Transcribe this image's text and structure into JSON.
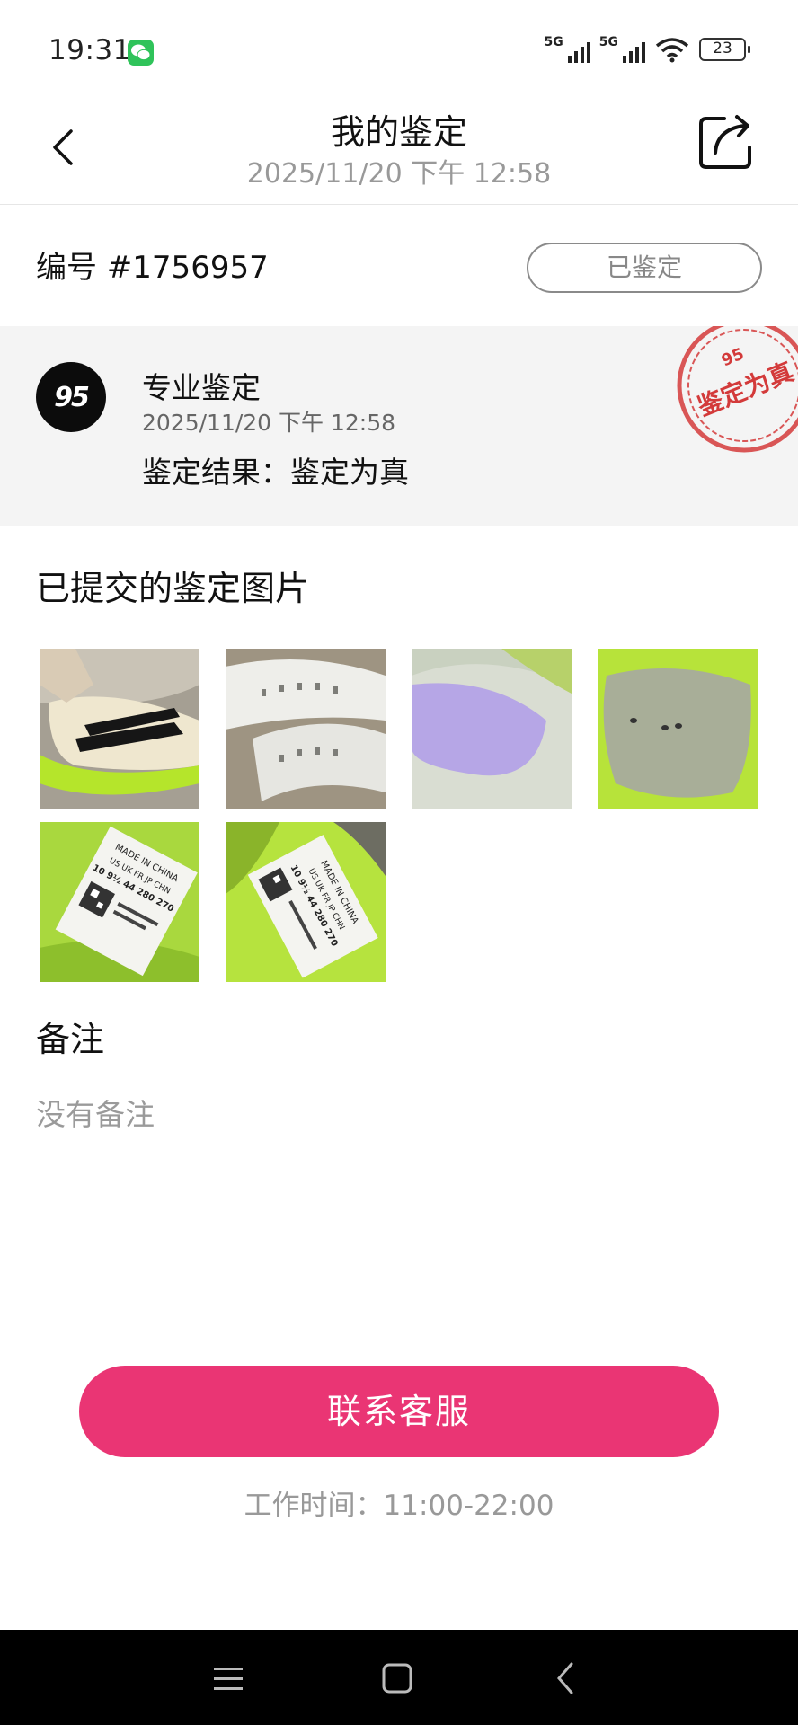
{
  "status_bar": {
    "time": "19:31",
    "battery": "23",
    "network_1": "5G",
    "network_2": "5G"
  },
  "header": {
    "title": "我的鉴定",
    "subtitle": "2025/11/20 下午 12:58"
  },
  "order": {
    "number": "编号 #1756957",
    "status": "已鉴定"
  },
  "result": {
    "logo_text": "95",
    "type": "专业鉴定",
    "time": "2025/11/20 下午 12:58",
    "line": "鉴定结果：鉴定为真",
    "stamp_text": "鉴定为真"
  },
  "images_section": {
    "title": "已提交的鉴定图片",
    "label_lines": [
      "MADE IN CHINA",
      "US UK FR JP CHN",
      "10 9½ 44 280 270"
    ]
  },
  "remark": {
    "title": "备注",
    "text": "没有备注"
  },
  "contact": {
    "button": "联系客服",
    "work_hours": "工作时间：11:00-22:00"
  },
  "colors": {
    "accent": "#ea3574",
    "stamp": "#d33a3a"
  }
}
